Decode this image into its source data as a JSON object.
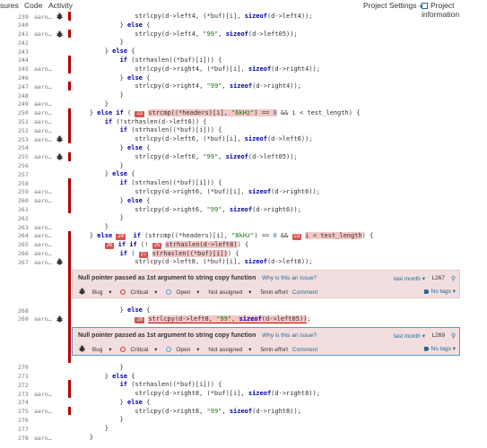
{
  "nav": {
    "left_items": [
      "sures",
      "Code",
      "Activity"
    ],
    "project_settings": "Project Settings",
    "project_information": "Project information"
  },
  "rows_a": [
    {
      "ln": "239",
      "author": "aaro…",
      "bug": true,
      "cov": true,
      "code": "                strlcpy(d->left4, (*buf)[i], sizeof(d->left4));"
    },
    {
      "ln": "240",
      "author": "",
      "bug": false,
      "cov": false,
      "code": "            } else {"
    },
    {
      "ln": "241",
      "author": "aaro…",
      "bug": true,
      "cov": true,
      "code": "                strlcpy(d->left4, \"99\", sizeof(d->left05));"
    },
    {
      "ln": "242",
      "author": "",
      "bug": false,
      "cov": false,
      "code": "            }"
    },
    {
      "ln": "243",
      "author": "",
      "bug": false,
      "cov": false,
      "code": "        } else {"
    },
    {
      "ln": "244",
      "author": "",
      "bug": false,
      "cov": true,
      "code": "            if (strhaslen((*buf)[i])) {"
    },
    {
      "ln": "245",
      "author": "aaro…",
      "bug": false,
      "cov": true,
      "code": "                strlcpy(d->right4, (*buf)[i], sizeof(d->right4));"
    },
    {
      "ln": "246",
      "author": "",
      "bug": false,
      "cov": false,
      "code": "            } else {"
    },
    {
      "ln": "247",
      "author": "aaro…",
      "bug": false,
      "cov": true,
      "code": "                strlcpy(d->right4, \"99\", sizeof(d->right4));"
    },
    {
      "ln": "248",
      "author": "",
      "bug": false,
      "cov": false,
      "code": "            }"
    },
    {
      "ln": "249",
      "author": "aaro…",
      "bug": false,
      "cov": false,
      "code": "        }"
    },
    {
      "ln": "250",
      "author": "aaro…",
      "bug": false,
      "cov": true,
      "code": "    } else if ( [22] strcmp((*headers)[i], \"6kHz\") == 0 && i < test_length) {",
      "markers": [
        {
          "n": "22",
          "text": "strcmp((*headers)[i], \"6kHz\") == 0",
          "pre": "    } else if ( ",
          "post": " && i < test_length) {"
        }
      ]
    },
    {
      "ln": "251",
      "author": "aaro…",
      "bug": false,
      "cov": true,
      "code": "        if (!strhaslen(d->left6)) {"
    },
    {
      "ln": "252",
      "author": "aaro…",
      "bug": false,
      "cov": true,
      "code": "            if (strhaslen((*buf)[i])) {"
    },
    {
      "ln": "253",
      "author": "aaro…",
      "bug": true,
      "cov": true,
      "code": "                strlcpy(d->left6, (*buf)[i], sizeof(d->left6));"
    },
    {
      "ln": "254",
      "author": "",
      "bug": false,
      "cov": false,
      "code": "            } else {"
    },
    {
      "ln": "255",
      "author": "aaro…",
      "bug": true,
      "cov": true,
      "code": "                strlcpy(d->left6, \"99\", sizeof(d->left05));"
    },
    {
      "ln": "256",
      "author": "",
      "bug": false,
      "cov": false,
      "code": "            }"
    },
    {
      "ln": "257",
      "author": "",
      "bug": false,
      "cov": false,
      "code": "        } else {"
    },
    {
      "ln": "258",
      "author": "",
      "bug": false,
      "cov": true,
      "code": "            if (strhaslen((*buf)[i])) {"
    },
    {
      "ln": "259",
      "author": "aaro…",
      "bug": false,
      "cov": true,
      "code": "                strlcpy(d->right6, (*buf)[i], sizeof(d->right6));"
    },
    {
      "ln": "260",
      "author": "aaro…",
      "bug": false,
      "cov": true,
      "code": "            } else {"
    },
    {
      "ln": "261",
      "author": "",
      "bug": false,
      "cov": true,
      "code": "                strlcpy(d->right6, \"99\", sizeof(d->right6));"
    },
    {
      "ln": "262",
      "author": "",
      "bug": false,
      "cov": false,
      "code": "            }"
    },
    {
      "ln": "263",
      "author": "aaro…",
      "bug": false,
      "cov": false,
      "code": "        }"
    }
  ],
  "row_264": {
    "ln": "264",
    "author": "aaro…",
    "pre": "    } else ",
    "m1": "24",
    "mid": " if (strcmp((*headers)[i], \"8kHz\") == 0 && ",
    "m2": "23",
    "hl": "i < test_length",
    "post": ") {"
  },
  "row_265": {
    "ln": "265",
    "author": "aaro…",
    "m1": "26",
    "pre2": " if (! ",
    "m2": "25",
    "hl": "strhaslen(d->left8)",
    "post": ") {"
  },
  "row_266": {
    "ln": "266",
    "author": "aaro…",
    "pre": "            if ( ",
    "m1": "27",
    "hl": "strhaslen((*buf)[i])",
    "post": ") {"
  },
  "row_267": {
    "ln": "267",
    "author": "aaro…",
    "code": "                strlcpy(d->left8, (*buf)[i], sizeof(d->left8));"
  },
  "issue1": {
    "title": "Null pointer passed as 1st argument to string copy function",
    "why": "Why is this an issue?",
    "when": "last month",
    "line": "L267",
    "type": "Bug",
    "severity": "Critical",
    "status": "Open",
    "assignee": "Not assigned",
    "effort": "5min effort",
    "comment": "Comment",
    "tags": "No tags"
  },
  "row_268": {
    "ln": "268",
    "code": "            } else {"
  },
  "row_269": {
    "ln": "269",
    "author": "aaro…",
    "pre": "                ",
    "m1": "28",
    "hl": "strlcpy(d->left8, \"99\", sizeof(d->left05))",
    "post": ";"
  },
  "issue2": {
    "title": "Null pointer passed as 1st argument to string copy function",
    "why": "Why is this an issue?",
    "when": "last month",
    "line": "L269",
    "type": "Bug",
    "severity": "Critical",
    "status": "Open",
    "assignee": "Not assigned",
    "effort": "5min effort",
    "comment": "Comment",
    "tags": "No tags"
  },
  "rows_b": [
    {
      "ln": "270",
      "author": "",
      "bug": false,
      "cov": false,
      "code": "            }"
    },
    {
      "ln": "271",
      "author": "",
      "bug": false,
      "cov": false,
      "code": "        } else {"
    },
    {
      "ln": "272",
      "author": "",
      "bug": false,
      "cov": true,
      "code": "            if (strhaslen((*buf)[i])) {"
    },
    {
      "ln": "273",
      "author": "aaro…",
      "bug": false,
      "cov": true,
      "code": "                strlcpy(d->right8, (*buf)[i], sizeof(d->right8));"
    },
    {
      "ln": "274",
      "author": "",
      "bug": false,
      "cov": false,
      "code": "            } else {"
    },
    {
      "ln": "275",
      "author": "aaro…",
      "bug": false,
      "cov": true,
      "code": "                strlcpy(d->right8, \"99\", sizeof(d->right8));"
    },
    {
      "ln": "276",
      "author": "",
      "bug": false,
      "cov": false,
      "code": "            }"
    },
    {
      "ln": "277",
      "author": "",
      "bug": false,
      "cov": false,
      "code": "        }"
    },
    {
      "ln": "278",
      "author": "aaro…",
      "bug": false,
      "cov": false,
      "code": "    }"
    }
  ],
  "colors": {
    "coverage": "#b40000",
    "issue_bg": "#f2dede",
    "active_border": "#4b9fd5",
    "link": "#236a97"
  }
}
